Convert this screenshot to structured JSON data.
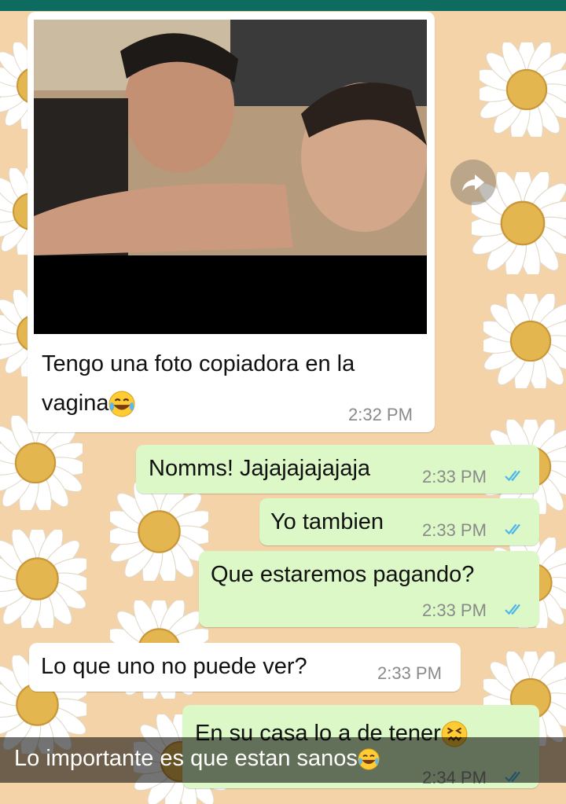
{
  "messages": [
    {
      "direction": "incoming",
      "type": "image",
      "caption_line1": "Tengo una foto copiadora en la",
      "caption_line2": "vagina",
      "emoji": "face-with-tears-of-joy",
      "time": "2:32 PM"
    },
    {
      "direction": "outgoing",
      "text": "Nomms! Jajajajajajaja",
      "time": "2:33 PM",
      "status": "read"
    },
    {
      "direction": "outgoing",
      "text": "Yo tambien",
      "time": "2:33 PM",
      "status": "read"
    },
    {
      "direction": "outgoing",
      "text": "Que estaremos pagando?",
      "time": "2:33 PM",
      "status": "read"
    },
    {
      "direction": "incoming",
      "text": "Lo que uno no puede ver?",
      "time": "2:33 PM"
    },
    {
      "direction": "outgoing",
      "text": "En su casa lo a de tener",
      "emoji": "confounded-face",
      "time": "2:34 PM",
      "status": "read"
    }
  ],
  "caption": {
    "text": "Lo importante es que estan sanos",
    "emoji": "face-with-tears-of-joy"
  },
  "icons": {
    "forward": "forward-share-icon",
    "read_ticks": "double-check-icon"
  },
  "colors": {
    "header": "#0e6b5f",
    "wallpaper": "#f4d3a8",
    "incoming_bubble": "#ffffff",
    "outgoing_bubble": "#dcf8c6",
    "read_ticks": "#4fb6ec",
    "timestamp": "#8a8a8a"
  }
}
